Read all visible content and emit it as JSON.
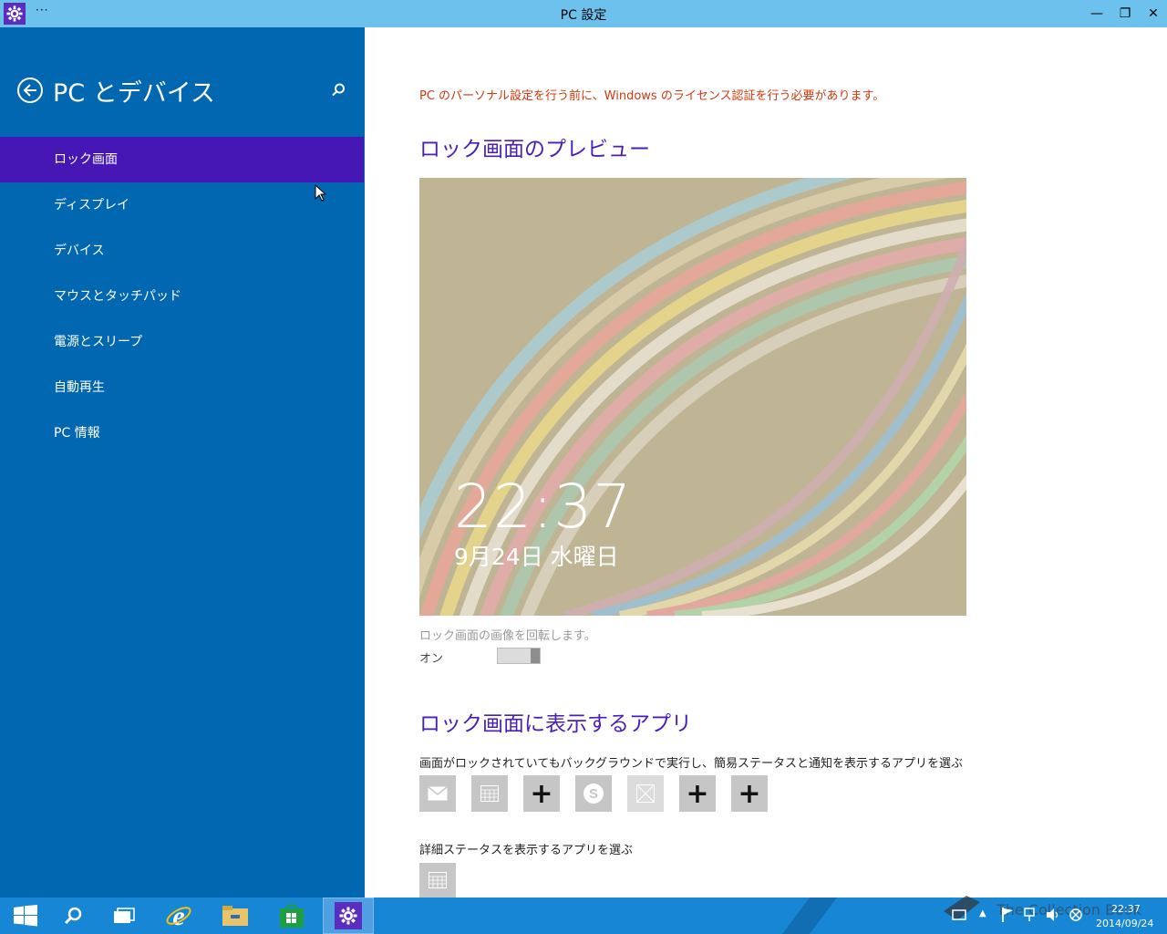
{
  "window": {
    "title": "PC 設定",
    "menu_dots": "···",
    "minimize_glyph": "—",
    "restore_glyph": "❐",
    "close_glyph": "✕"
  },
  "sidebar": {
    "title": "PC とデバイス",
    "items": [
      {
        "label": "ロック画面",
        "active": true
      },
      {
        "label": "ディスプレイ"
      },
      {
        "label": "デバイス"
      },
      {
        "label": "マウスとタッチパッド"
      },
      {
        "label": "電源とスリープ"
      },
      {
        "label": "自動再生"
      },
      {
        "label": "PC 情報"
      }
    ]
  },
  "content": {
    "warning": "PC のパーソナル設定を行う前に、Windows のライセンス認証を行う必要があります。",
    "preview_heading": "ロック画面のプレビュー",
    "preview_time": "22:37",
    "preview_date": "9月24日 水曜日",
    "slideshow_label": "ロック画面の画像を回転します。",
    "toggle_state": "オン",
    "apps_heading": "ロック画面に表示するアプリ",
    "apps_desc": "画面がロックされていてもバックグラウンドで実行し、簡易ステータスと通知を表示するアプリを選ぶ",
    "detail_desc": "詳細ステータスを表示するアプリを選ぶ",
    "app_slots": [
      "mail-icon",
      "calendar-icon",
      "add",
      "skype-icon",
      "disabled-app-icon",
      "add",
      "add"
    ],
    "add_glyph": "+"
  },
  "taskbar": {
    "time": "22:37",
    "date": "2014/09/24",
    "watermark": "The Collection Book"
  },
  "colors": {
    "sidebar": "#0067b0",
    "active": "#4617b4",
    "titlebar": "#6cc2ec",
    "heading": "#4a1fb8",
    "warning": "#d4380d",
    "taskbar": "#1686d5"
  }
}
